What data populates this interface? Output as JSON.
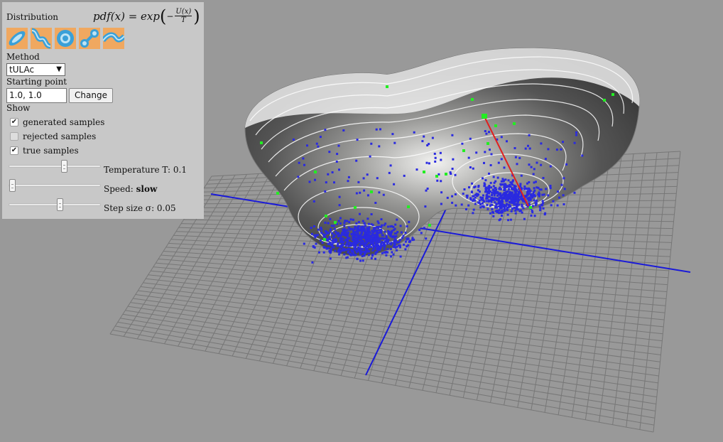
{
  "panel": {
    "distribution_label": "Distribution",
    "formula": {
      "lhs": "pdf(x) = exp",
      "minus": "−",
      "numerator": "U(x)",
      "denominator": "T"
    },
    "distributions": [
      {
        "name": "ellipse-distribution-icon"
      },
      {
        "name": "banana-distribution-icon"
      },
      {
        "name": "donut-distribution-icon"
      },
      {
        "name": "bimodal-distribution-icon",
        "selected": true
      },
      {
        "name": "wave-distribution-icon"
      }
    ],
    "method_label": "Method",
    "method_value": "tULAc",
    "starting_point_label": "Starting point",
    "starting_point_value": "1.0, 1.0",
    "change_label": "Change",
    "show_label": "Show",
    "checkboxes": [
      {
        "label": "generated samples",
        "checked": true
      },
      {
        "label": "rejected samples",
        "checked": false
      },
      {
        "label": "true samples",
        "checked": true
      }
    ],
    "sliders": {
      "temperature": {
        "label": "Temperature T: 0.1",
        "position": 0.6
      },
      "speed": {
        "label_prefix": "Speed: ",
        "label_value": "slow",
        "position": 0.0
      },
      "step_size": {
        "label": "Step size σ: 0.05",
        "position": 0.55
      }
    }
  },
  "scene": {
    "colors": {
      "background": "#999999",
      "grid": "#777777",
      "axis": "#1a1ad8",
      "true_samples": "#2a2ae0",
      "generated_samples": "#22ee22",
      "current_step": "#e02020"
    }
  }
}
